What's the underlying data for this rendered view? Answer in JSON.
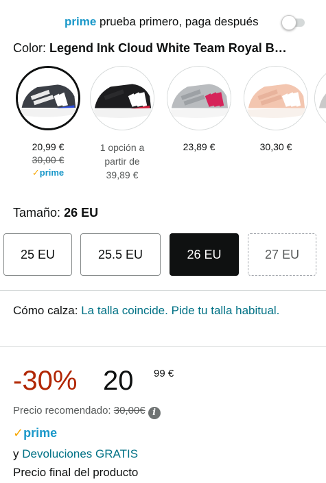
{
  "prime_try": {
    "brand": "prime",
    "text": "prueba primero, paga después",
    "toggle_on": false
  },
  "color": {
    "label": "Color:",
    "value": "Legend Ink Cloud White Team Royal B…"
  },
  "swatches": [
    {
      "price": "20,99 €",
      "old_price": "30,00 €",
      "prime": "prime",
      "selected": true
    },
    {
      "options_line1": "1 opción a",
      "options_line2": "partir de",
      "options_line3": "39,89 €",
      "selected": false
    },
    {
      "price": "23,89 €",
      "selected": false
    },
    {
      "price": "30,30 €",
      "selected": false
    }
  ],
  "size": {
    "label": "Tamaño:",
    "value": "26 EU",
    "options": [
      "25 EU",
      "25.5 EU",
      "26 EU",
      "27 EU"
    ]
  },
  "fit": {
    "prefix": "Cómo calza:",
    "link": "La talla coincide. Pide tu talla habitual."
  },
  "price": {
    "discount": "-30%",
    "whole": "20",
    "cents": "99 €",
    "recommended_label": "Precio recomendado:",
    "recommended_value": "30,00€",
    "info_icon": "i"
  },
  "prime_badge": "prime",
  "returns": {
    "prefix": "y",
    "link": "Devoluciones GRATIS"
  },
  "final_price": "Precio final del producto",
  "colors": {
    "accent_link": "#007185",
    "prime_blue": "#1a98c9",
    "discount_red": "#b12704",
    "prime_check": "#f7a600"
  }
}
